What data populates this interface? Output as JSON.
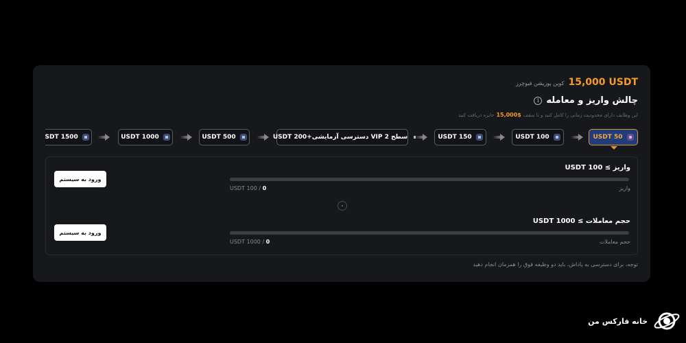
{
  "header": {
    "amount": "15,000 USDT",
    "coupon_label": "کوپن پوزیشن فیوچرز",
    "title": "چالش واریز و معامله",
    "info_icon": "info-icon",
    "subtitle_prefix": "این وظایف دارای محدودیت زمانی را کامل کنید و تا سقف",
    "subtitle_amount": "15,000$",
    "subtitle_suffix": "جایزه دریافت کنید"
  },
  "tiers": [
    {
      "label": "USDT 50",
      "active": true
    },
    {
      "label": "USDT 100",
      "active": false
    },
    {
      "label": "USDT 150",
      "active": false
    },
    {
      "label": "USDT 200+دسترسی آزمایشی VIP سطح 2",
      "active": false
    },
    {
      "label": "USDT 500",
      "active": false
    },
    {
      "label": "USDT 1000",
      "active": false
    },
    {
      "label": "USDT 1500",
      "active": false
    }
  ],
  "tasks": [
    {
      "title": "واریز ≥ 100 USDT",
      "label": "واریز",
      "current": "0",
      "target": "USDT 100 / ",
      "progress_fraction": 0,
      "button": "ورود به سیستم"
    },
    {
      "title": "حجم معاملات ≥ 1000 USDT",
      "label": "حجم معاملات",
      "current": "0",
      "target": "USDT 1000 / ",
      "progress_fraction": 0,
      "button": "ورود به سیستم"
    }
  ],
  "note": "توجه، برای دسترسی به پاداش، باید دو وظیفه فوق را همزمان انجام دهید",
  "brand": {
    "name": "خانه فارکس من",
    "logo_icon": "satellite-logo-icon"
  },
  "colors": {
    "accent": "#f39b2c",
    "active_tier_bg": "#1f3d7a",
    "panel_bg": "#17181c"
  }
}
